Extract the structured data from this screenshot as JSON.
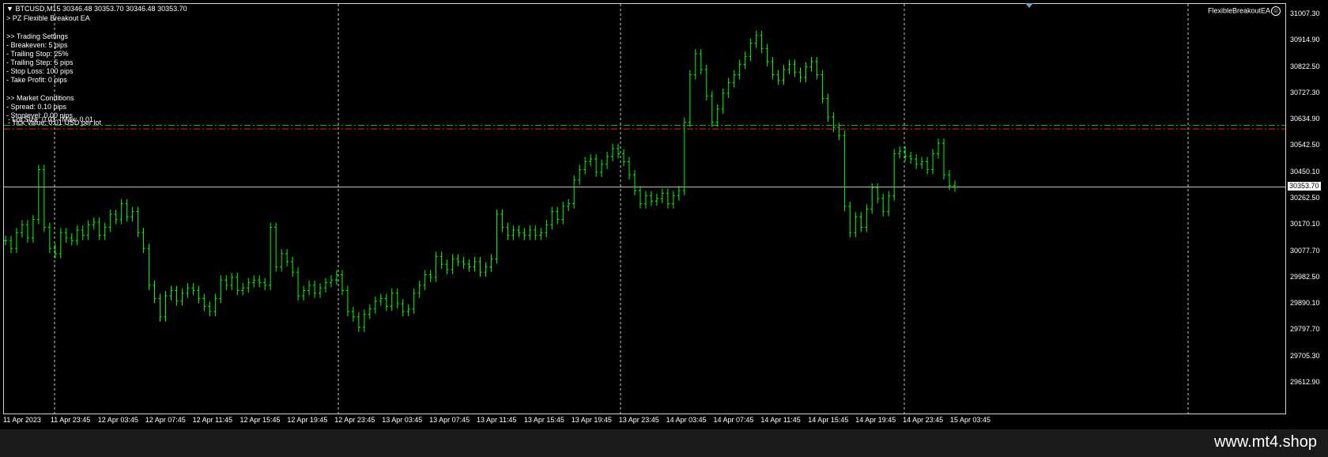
{
  "header": {
    "symbol_line": "BTCUSD,M15  30346.48 30353.70 30346.48 30353.70",
    "ea_name_line": "> PZ Flexible Breakout EA"
  },
  "info_panel": {
    "trading_settings_title": ">> Trading Settings",
    "breakeven": "- Breakeven: 5 pips",
    "trailing_stop": "- Trailing Stop: 25%",
    "trailing_step": "- Trailing Step: 5 pips",
    "stop_loss": "- Stop Loss: 100 pips",
    "take_profit": "- Take Profit: 0 pips",
    "market_conditions_title": ">> Market Conditions",
    "spread": "- Spread: 0.10 pips",
    "stoplevel": "- Stoplevel: 0.00 pips",
    "overlap_a": "- Tick Value: 0.01 USD per lot",
    "overlap_b": "- Lot Size: 0.01 - Max: 0.01"
  },
  "ea_badge": {
    "label": "FlexibleBreakoutEA",
    "icon": "smiley-icon"
  },
  "price_axis": {
    "labels": [
      "31007.30",
      "30914.90",
      "30822.50",
      "30727.30",
      "30634.90",
      "30542.50",
      "30450.10",
      "30262.50",
      "30170.10",
      "30077.70",
      "29982.50",
      "29890.10",
      "29797.70",
      "29705.30",
      "29612.90"
    ],
    "current_price": "30353.70"
  },
  "time_axis": {
    "labels": [
      "11 Apr 2023",
      "11 Apr 23:45",
      "12 Apr 03:45",
      "12 Apr 07:45",
      "12 Apr 11:45",
      "12 Apr 15:45",
      "12 Apr 19:45",
      "12 Apr 23:45",
      "13 Apr 03:45",
      "13 Apr 07:45",
      "13 Apr 11:45",
      "13 Apr 15:45",
      "13 Apr 19:45",
      "13 Apr 23:45",
      "14 Apr 03:45",
      "14 Apr 07:45",
      "14 Apr 11:45",
      "14 Apr 15:45",
      "14 Apr 19:45",
      "14 Apr 23:45",
      "15 Apr 03:45"
    ]
  },
  "colors": {
    "background": "#000000",
    "candle": "#00ff00",
    "grid": "#c8c8c8",
    "breakout_green": "#00c800",
    "breakout_red": "#ff2020",
    "bid_line": "#c0c0c0"
  },
  "levels": {
    "breakout_high": 30588,
    "breakout_low": 30574,
    "current": 30353.7
  },
  "chart_data": {
    "type": "line",
    "ylim": [
      29612.9,
      31007.3
    ],
    "series": [
      {
        "values": [
          30150,
          30120,
          30180,
          30210,
          30160,
          30230,
          30420,
          30200,
          30120,
          30100,
          30180,
          30160,
          30150,
          30190,
          30170,
          30210,
          30220,
          30170,
          30200,
          30250,
          30230,
          30290,
          30240,
          30260,
          30180,
          30120,
          29980,
          29930,
          29860,
          29940,
          29960,
          29920,
          29950,
          29970,
          29960,
          29930,
          29900,
          29880,
          29930,
          30000,
          29980,
          30010,
          29960,
          29970,
          29990,
          30000,
          29990,
          29980,
          30200,
          30050,
          30100,
          30070,
          30030,
          29940,
          29960,
          29980,
          29950,
          29970,
          29990,
          30000,
          30020,
          29960,
          29880,
          29860,
          29820,
          29870,
          29890,
          29920,
          29930,
          29900,
          29950,
          29910,
          29880,
          29890,
          29950,
          29980,
          30020,
          30010,
          30090,
          30060,
          30040,
          30080,
          30070,
          30060,
          30050,
          30070,
          30030,
          30050,
          30080,
          30250,
          30200,
          30170,
          30190,
          30180,
          30170,
          30190,
          30170,
          30180,
          30210,
          30260,
          30230,
          30280,
          30290,
          30380,
          30420,
          30450,
          30460,
          30410,
          30440,
          30470,
          30500,
          30480,
          30450,
          30400,
          30340,
          30290,
          30320,
          30300,
          30310,
          30330,
          30290,
          30320,
          30340,
          30600,
          30780,
          30860,
          30800,
          30700,
          30600,
          30650,
          30710,
          30750,
          30780,
          30820,
          30850,
          30900,
          30930,
          30880,
          30830,
          30780,
          30760,
          30800,
          30820,
          30790,
          30770,
          30810,
          30830,
          30780,
          30690,
          30620,
          30580,
          30550,
          30280,
          30180,
          30240,
          30200,
          30270,
          30350,
          30310,
          30260,
          30320,
          30480,
          30490,
          30470,
          30460,
          30440,
          30450,
          30420,
          30480,
          30520,
          30400,
          30360,
          30353.7
        ]
      }
    ]
  },
  "watermark": "www.mt4.shop"
}
